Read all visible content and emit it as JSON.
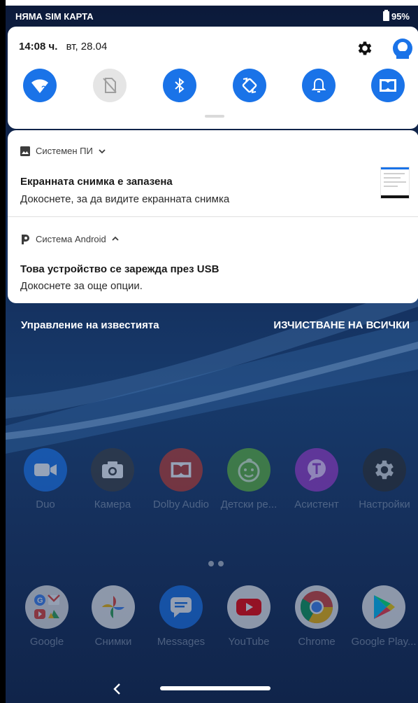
{
  "status_bar": {
    "carrier": "НЯМА SIM КАРТА",
    "battery": "95%"
  },
  "quick_settings": {
    "time": "14:08 ч.",
    "date": "вт, 28.04",
    "tiles": [
      {
        "name": "wifi",
        "icon": "wifi-question-icon",
        "state": "on"
      },
      {
        "name": "sim",
        "icon": "no-sim-icon",
        "state": "off"
      },
      {
        "name": "bluetooth",
        "icon": "bluetooth-icon",
        "state": "on"
      },
      {
        "name": "auto-rotate",
        "icon": "auto-rotate-icon",
        "state": "on"
      },
      {
        "name": "sound",
        "icon": "bell-icon",
        "state": "on"
      },
      {
        "name": "dolby",
        "icon": "dolby-icon",
        "state": "on"
      }
    ],
    "accent": "#1a73e8"
  },
  "notifications": [
    {
      "app": "Системен ПИ",
      "expand": "chevron-down-icon",
      "title": "Екранната снимка е запазена",
      "text": "Докоснете, за да видите екранната снимка"
    },
    {
      "app": "Система Android",
      "expand": "chevron-up-icon",
      "title": "Това устройство се зарежда през USB",
      "text": "Докоснете за още опции."
    }
  ],
  "notif_footer": {
    "manage": "Управление на известията",
    "clear_all": "ИЗЧИСТВАНЕ НА ВСИЧКИ"
  },
  "apps_row1": [
    {
      "label": "Duo",
      "icon": "duo-icon",
      "color": "#1a73e8"
    },
    {
      "label": "Камера",
      "icon": "camera-icon",
      "color": "#3c3c3c"
    },
    {
      "label": "Dolby Audio",
      "icon": "dolby-icon",
      "color": "#c0392b"
    },
    {
      "label": "Детски ре...",
      "icon": "kids-icon",
      "color": "#5fb336"
    },
    {
      "label": "Асистент",
      "icon": "assistant-icon",
      "color": "#9b38c6"
    },
    {
      "label": "Настройки",
      "icon": "settings-icon",
      "color": "#2b2b2b"
    }
  ],
  "apps_row2": [
    {
      "label": "Google",
      "icon": "google-folder-icon",
      "color": "#e8e8e8"
    },
    {
      "label": "Снимки",
      "icon": "photos-icon",
      "color": "#f1f1f1"
    },
    {
      "label": "Messages",
      "icon": "messages-icon",
      "color": "#1a73e8"
    },
    {
      "label": "YouTube",
      "icon": "youtube-icon",
      "color": "#f1f1f1"
    },
    {
      "label": "Chrome",
      "icon": "chrome-icon",
      "color": "#f1f1f1"
    },
    {
      "label": "Google Play...",
      "icon": "play-store-icon",
      "color": "#f1f1f1"
    }
  ]
}
